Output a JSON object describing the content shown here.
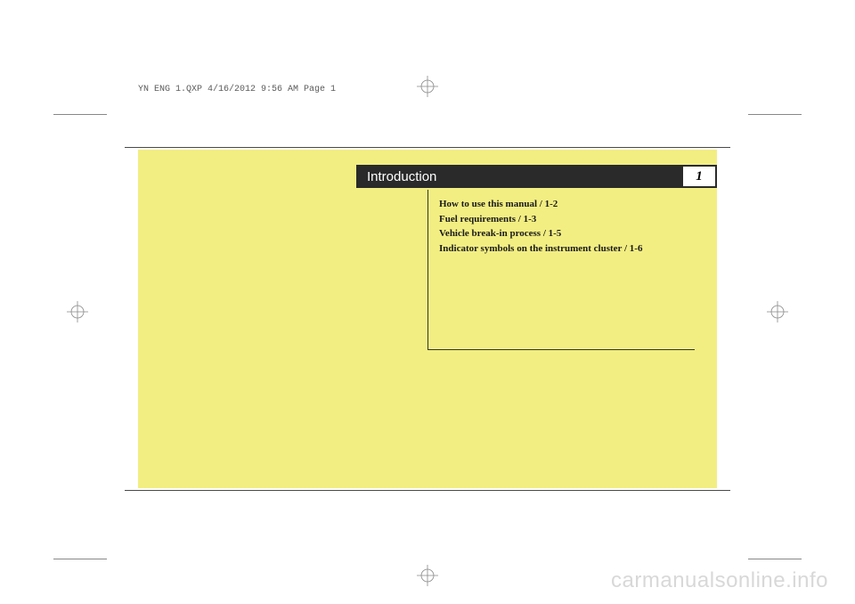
{
  "header": {
    "slug": "YN ENG 1.QXP  4/16/2012  9:56 AM  Page 1"
  },
  "chapter": {
    "title": "Introduction",
    "number": "1"
  },
  "toc": {
    "items": [
      "How to use this manual / 1-2",
      "Fuel requirements / 1-3",
      "Vehicle break-in process / 1-5",
      "Indicator symbols on the instrument cluster / 1-6"
    ]
  },
  "watermark": "carmanualsonline.info"
}
